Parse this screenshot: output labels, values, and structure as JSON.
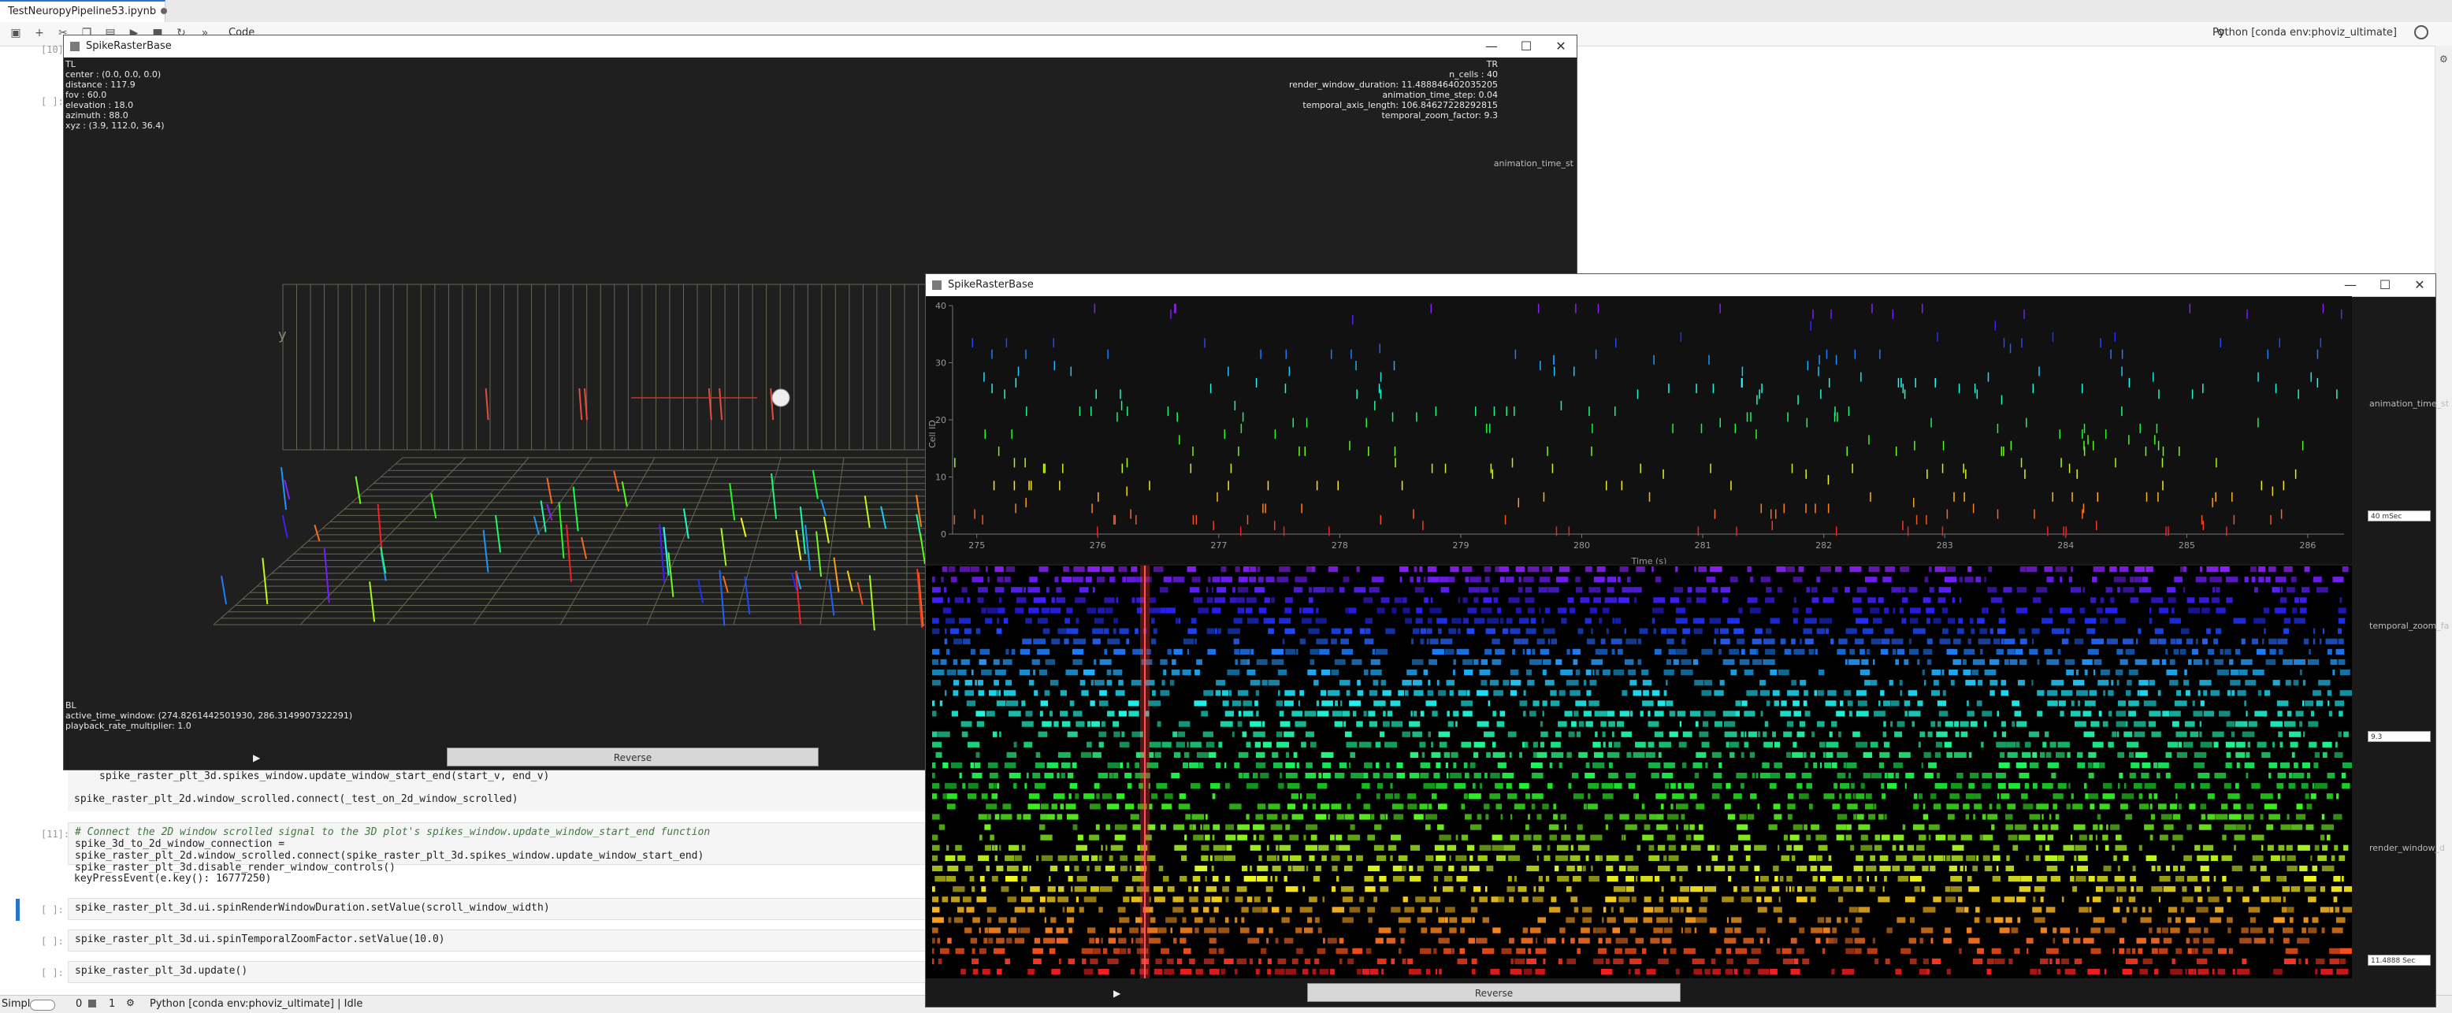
{
  "tab": {
    "title": "TestNeuropyPipeline53.ipynb"
  },
  "toolbar": {
    "cell_type": "Code",
    "kernel": "Python [conda env:phoviz_ultimate]"
  },
  "notebook": {
    "prompts": [
      "[10]:",
      "[ ]:",
      "[11]:",
      "[ ]:",
      "[ ]:",
      "[ ]:"
    ],
    "cells": {
      "line1": "spike_raster_plt_3d.spikes_window.update_window_start_end(start_v, end_v)",
      "line2": "spike_raster_plt_2d.window_scrolled.connect(_test_on_2d_window_scrolled)",
      "comment": "# Connect the 2D window scrolled signal to the 3D plot's spikes_window.update_window_start_end function",
      "line3": "spike_3d_to_2d_window_connection = spike_raster_plt_2d.window_scrolled.connect(spike_raster_plt_3d.spikes_window.update_window_start_end)",
      "line4": "spike_raster_plt_3d.disable_render_window_controls()",
      "output": "keyPressEvent(e.key(): 16777250)",
      "line5": "spike_raster_plt_3d.ui.spinRenderWindowDuration.setValue(scroll_window_width)",
      "line6": "spike_raster_plt_3d.ui.spinTemporalZoomFactor.setValue(10.0)",
      "line7": "spike_raster_plt_3d.update()"
    }
  },
  "status": {
    "mode": "Simple",
    "count0": "0",
    "count1": "1",
    "kernel": "Python [conda env:phoviz_ultimate] | Idle"
  },
  "win3d": {
    "title": "SpikeRasterBase",
    "tl": "TL\ncenter : (0.0, 0.0, 0.0)\ndistance : 117.9\nfov : 60.0\nelevation : 18.0\nazimuth : 88.0\nxyz : (3.9, 112.0, 36.4)",
    "tr": "TR\nn_cells : 40\nrender_window_duration: 11.488846402035205\nanimation_time_step: 0.04\ntemporal_axis_length: 106.84627228292815\ntemporal_zoom_factor: 9.3",
    "bl": "BL\nactive_time_window: (274.8261442501930, 286.3149907322291)\nplayback_rate_multiplier: 1.0",
    "side_label": "animation_time_st",
    "axis_y": "y",
    "reverse": "Reverse",
    "play": "▶"
  },
  "win2d": {
    "title": "SpikeRasterBase",
    "ylabel": "Cell ID",
    "xlabel": "Time (s)",
    "reverse": "Reverse",
    "play": "▶",
    "side_labels": [
      "animation_time_st",
      "temporal_zoom_fa",
      "render_window_d"
    ],
    "spin_values": [
      "40 mSec",
      "9.3",
      "11.4888 Sec"
    ]
  },
  "chart_data": {
    "type": "scatter",
    "title": "",
    "xlabel": "Time (s)",
    "ylabel": "Cell ID",
    "xlim": [
      274.8,
      286.3
    ],
    "ylim": [
      0,
      40
    ],
    "x_ticks": [
      275,
      276,
      277,
      278,
      279,
      280,
      281,
      282,
      283,
      284,
      285,
      286
    ],
    "y_ticks": [
      0,
      10,
      20,
      30,
      40
    ],
    "n_cells": 40,
    "active_window_start": 274.826144250193,
    "active_window_end": 286.3149907322291
  },
  "colors": {
    "accent": "#2a73c9",
    "cursor_line": "#ff3b3b",
    "grid": "#8a8a6a"
  }
}
